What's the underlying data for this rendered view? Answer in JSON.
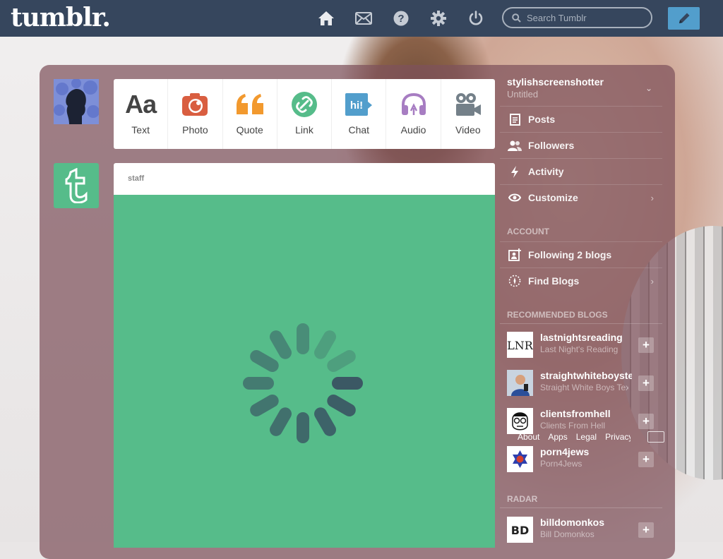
{
  "header": {
    "logo": "tumblr.",
    "search_placeholder": "Search Tumblr"
  },
  "post_types": [
    {
      "label": "Text",
      "icon": "text-icon",
      "color": "#444444"
    },
    {
      "label": "Photo",
      "icon": "camera-icon",
      "color": "#d95e40"
    },
    {
      "label": "Quote",
      "icon": "quote-icon",
      "color": "#f2992e"
    },
    {
      "label": "Link",
      "icon": "link-icon",
      "color": "#56bc8a"
    },
    {
      "label": "Chat",
      "icon": "chat-icon",
      "color": "#529ecc"
    },
    {
      "label": "Audio",
      "icon": "headphones-icon",
      "color": "#a77dc2"
    },
    {
      "label": "Video",
      "icon": "video-camera-icon",
      "color": "#748089"
    }
  ],
  "post": {
    "author": "staff",
    "body_color": "#56bc8a"
  },
  "sidebar": {
    "blog_name": "stylishscreenshotter",
    "blog_subtitle": "Untitled",
    "menu": [
      {
        "label": "Posts",
        "icon": "posts-icon"
      },
      {
        "label": "Followers",
        "icon": "followers-icon"
      },
      {
        "label": "Activity",
        "icon": "activity-icon"
      },
      {
        "label": "Customize",
        "icon": "eye-icon"
      }
    ],
    "account_heading": "ACCOUNT",
    "account_menu": [
      {
        "label": "Following 2 blogs",
        "icon": "following-icon"
      },
      {
        "label": "Find Blogs",
        "icon": "compass-icon"
      }
    ],
    "recommended_heading": "RECOMMENDED BLOGS",
    "recommended": [
      {
        "name": "lastnightsreading",
        "subtitle": "Last Night's Reading"
      },
      {
        "name": "straightwhiteboystexting",
        "subtitle": "Straight White Boys Texting"
      },
      {
        "name": "clientsfromhell",
        "subtitle": "Clients From Hell"
      },
      {
        "name": "porn4jews",
        "subtitle": "Porn4Jews"
      }
    ],
    "footer_links": [
      "About",
      "Apps",
      "Legal",
      "Privacy"
    ],
    "radar_heading": "RADAR",
    "radar": {
      "name": "billdomonkos",
      "subtitle": "Bill Domonkos"
    }
  }
}
